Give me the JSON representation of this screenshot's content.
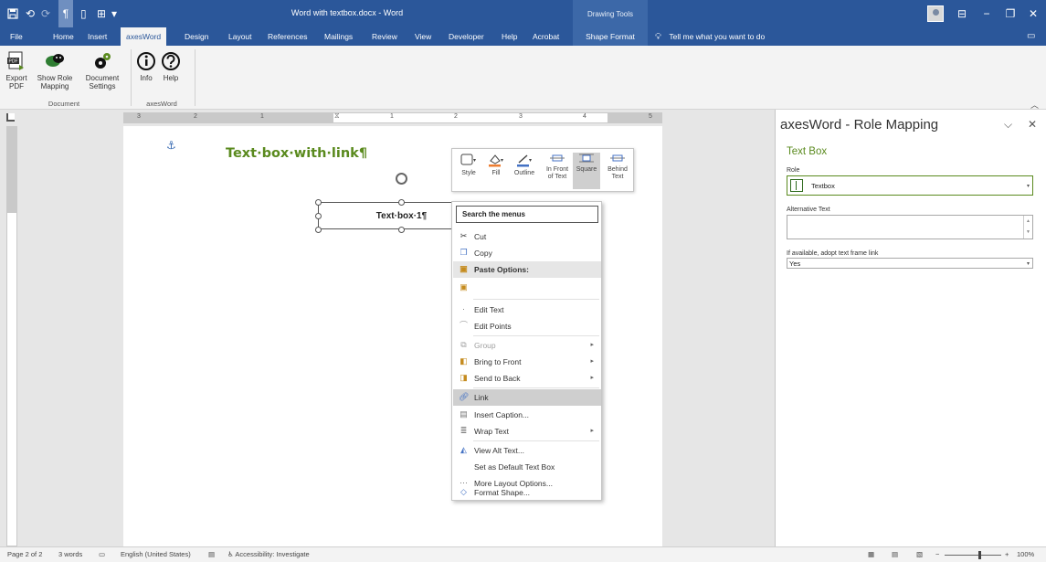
{
  "titlebar": {
    "document_title": "Word with textbox.docx  -  Word",
    "context_title": "Drawing Tools"
  },
  "tabs": [
    {
      "label": "File"
    },
    {
      "label": "Home"
    },
    {
      "label": "Insert"
    },
    {
      "label": "axesWord"
    },
    {
      "label": "Design"
    },
    {
      "label": "Layout"
    },
    {
      "label": "References"
    },
    {
      "label": "Mailings"
    },
    {
      "label": "Review"
    },
    {
      "label": "View"
    },
    {
      "label": "Developer"
    },
    {
      "label": "Help"
    },
    {
      "label": "Acrobat"
    },
    {
      "label": "Shape Format"
    }
  ],
  "tell_me": "Tell me what you want to do",
  "ribbon": {
    "export_pdf": [
      "Export",
      "PDF"
    ],
    "show_role_mapping": [
      "Show Role",
      "Mapping"
    ],
    "document_settings": [
      "Document",
      "Settings"
    ],
    "info": "Info",
    "help": "Help",
    "group_document": "Document",
    "group_axesword": "axesWord"
  },
  "ruler": {
    "numbers": [
      "3",
      "2",
      "1",
      "1",
      "2",
      "3",
      "4",
      "5"
    ]
  },
  "document": {
    "heading": "Text·box·with·link¶",
    "textbox_text": "Text·box·1¶"
  },
  "minitoolbar": {
    "style": "Style",
    "fill": "Fill",
    "outline": "Outline",
    "in_front": [
      "In Front",
      "of Text"
    ],
    "square": "Square",
    "behind": [
      "Behind",
      "Text"
    ]
  },
  "contextmenu": {
    "search": "Search the menus",
    "items": [
      {
        "label": "Cut"
      },
      {
        "label": "Copy"
      },
      {
        "label": "Paste Options:"
      },
      {
        "label": "Edit Text"
      },
      {
        "label": "Edit Points"
      },
      {
        "label": "Group"
      },
      {
        "label": "Bring to Front"
      },
      {
        "label": "Send to Back"
      },
      {
        "label": "Link"
      },
      {
        "label": "Insert Caption..."
      },
      {
        "label": "Wrap Text"
      },
      {
        "label": "View Alt Text..."
      },
      {
        "label": "Set as Default Text Box"
      },
      {
        "label": "More Layout Options..."
      },
      {
        "label": "Format Shape..."
      }
    ]
  },
  "pane": {
    "title": "axesWord - Role Mapping",
    "section": "Text Box",
    "role_label": "Role",
    "role_value": "Textbox",
    "alt_label": "Alternative Text",
    "alt_value": "",
    "adopt_label": "If available, adopt text frame link",
    "adopt_value": "Yes"
  },
  "status": {
    "page": "Page 2 of 2",
    "words": "3 words",
    "language": "English (United States)",
    "accessibility": "Accessibility: Investigate",
    "zoom": "100%"
  },
  "colors": {
    "word_blue": "#2b579a",
    "heading_green": "#5a8a1e"
  }
}
